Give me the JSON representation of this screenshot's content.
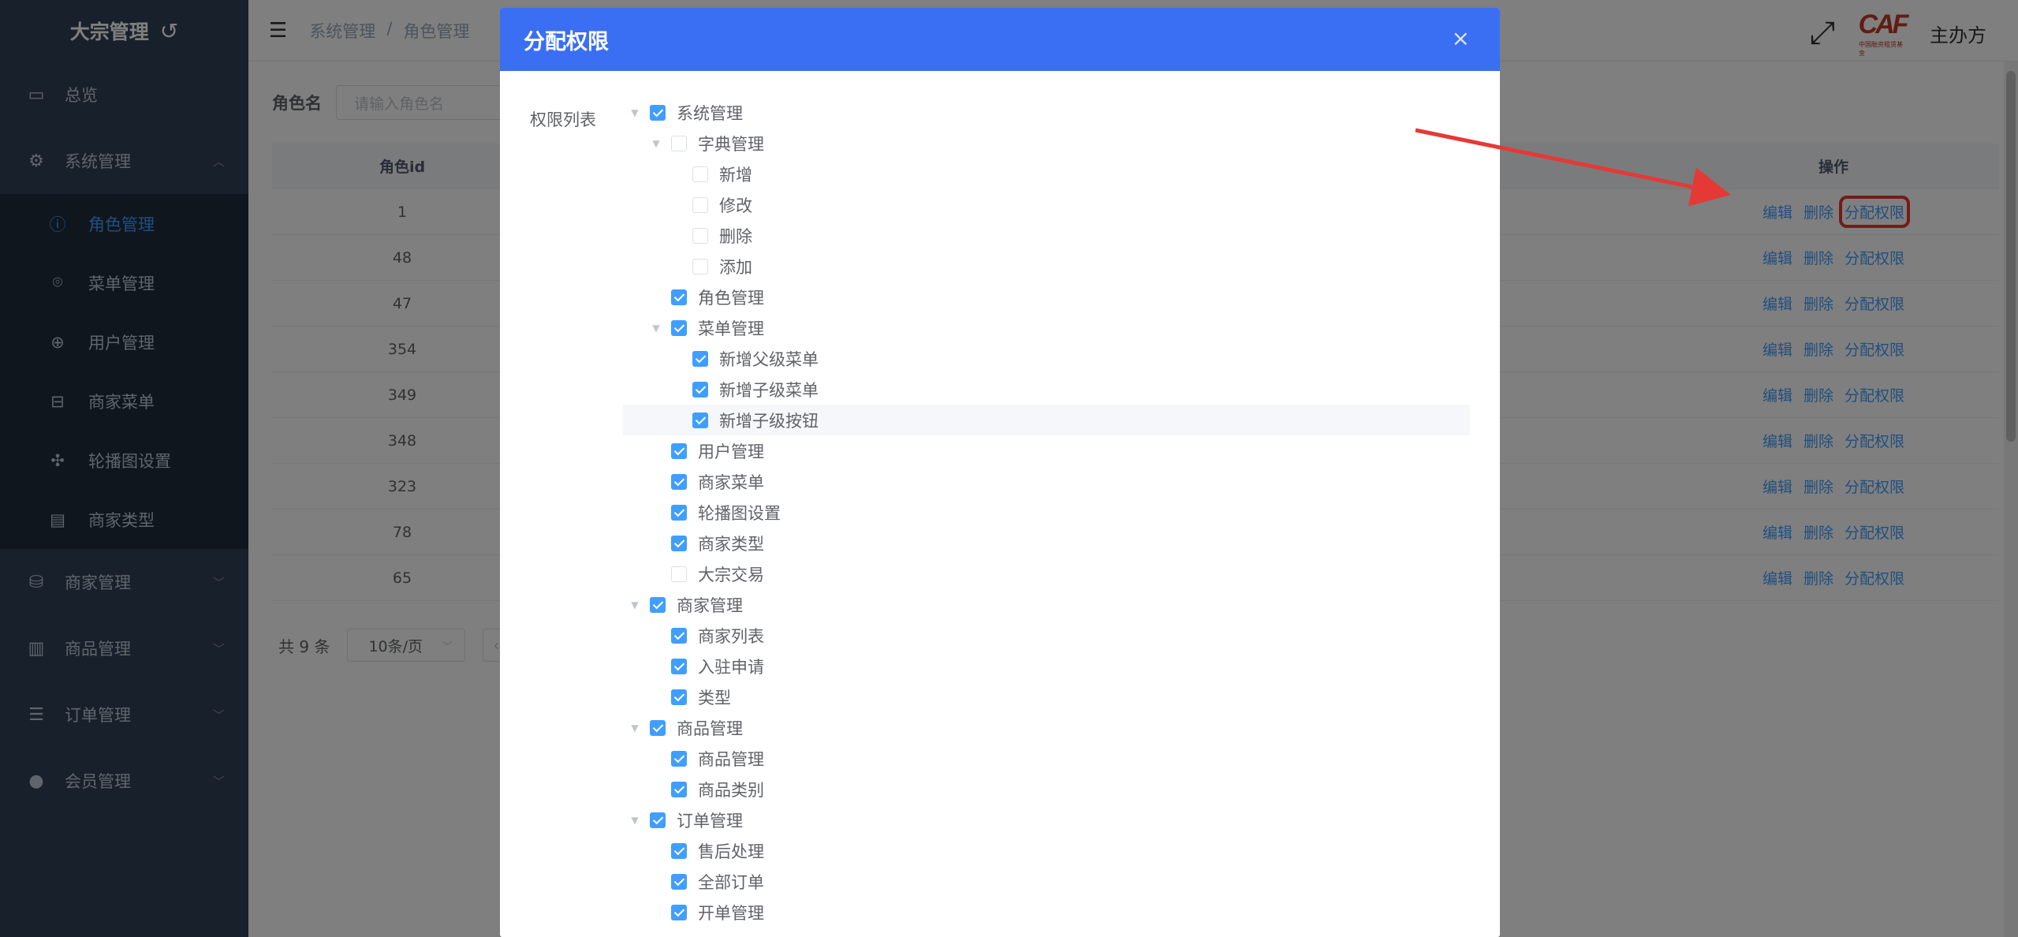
{
  "sidebar": {
    "title": "大宗管理",
    "swap_icon": "↺",
    "items": [
      {
        "label": "总览"
      },
      {
        "label": "系统管理"
      },
      {
        "label": "商家管理"
      },
      {
        "label": "商品管理"
      },
      {
        "label": "订单管理"
      },
      {
        "label": "会员管理"
      }
    ],
    "sub_items": [
      {
        "label": "角色管理"
      },
      {
        "label": "菜单管理"
      },
      {
        "label": "用户管理"
      },
      {
        "label": "商家菜单"
      },
      {
        "label": "轮播图设置"
      },
      {
        "label": "商家类型"
      }
    ]
  },
  "navbar": {
    "breadcrumb": [
      "系统管理",
      "/",
      "角色管理"
    ],
    "username": "主办方",
    "logo_text": "CAF",
    "logo_sub": "中国融资租赁基金"
  },
  "search": {
    "label": "角色名",
    "placeholder": "请输入角色名"
  },
  "table": {
    "headers": {
      "id": "角色id",
      "op": "操作"
    },
    "actions": {
      "edit": "编辑",
      "delete": "删除",
      "assign": "分配权限"
    },
    "rows": [
      {
        "id": "1"
      },
      {
        "id": "48"
      },
      {
        "id": "47"
      },
      {
        "id": "354"
      },
      {
        "id": "349"
      },
      {
        "id": "348"
      },
      {
        "id": "323"
      },
      {
        "id": "78"
      },
      {
        "id": "65"
      }
    ]
  },
  "pager": {
    "total": "共 9 条",
    "page_size": "10条/页"
  },
  "dialog": {
    "title": "分配权限",
    "close": "×",
    "perm_label": "权限列表",
    "tree": [
      {
        "label": "系统管理",
        "level": 0,
        "checked": true,
        "expand": true
      },
      {
        "label": "字典管理",
        "level": 1,
        "checked": false,
        "expand": true
      },
      {
        "label": "新增",
        "level": 2,
        "checked": false,
        "expand": false
      },
      {
        "label": "修改",
        "level": 2,
        "checked": false,
        "expand": false
      },
      {
        "label": "删除",
        "level": 2,
        "checked": false,
        "expand": false
      },
      {
        "label": "添加",
        "level": 2,
        "checked": false,
        "expand": false
      },
      {
        "label": "角色管理",
        "level": 1,
        "checked": true,
        "expand": false
      },
      {
        "label": "菜单管理",
        "level": 1,
        "checked": true,
        "expand": true
      },
      {
        "label": "新增父级菜单",
        "level": 2,
        "checked": true,
        "expand": false
      },
      {
        "label": "新增子级菜单",
        "level": 2,
        "checked": true,
        "expand": false
      },
      {
        "label": "新增子级按钮",
        "level": 2,
        "checked": true,
        "expand": false,
        "hover": true
      },
      {
        "label": "用户管理",
        "level": 1,
        "checked": true,
        "expand": false
      },
      {
        "label": "商家菜单",
        "level": 1,
        "checked": true,
        "expand": false
      },
      {
        "label": "轮播图设置",
        "level": 1,
        "checked": true,
        "expand": false
      },
      {
        "label": "商家类型",
        "level": 1,
        "checked": true,
        "expand": false
      },
      {
        "label": "大宗交易",
        "level": 1,
        "checked": false,
        "expand": false
      },
      {
        "label": "商家管理",
        "level": 0,
        "checked": true,
        "expand": true
      },
      {
        "label": "商家列表",
        "level": 1,
        "checked": true,
        "expand": false
      },
      {
        "label": "入驻申请",
        "level": 1,
        "checked": true,
        "expand": false
      },
      {
        "label": "类型",
        "level": 1,
        "checked": true,
        "expand": false
      },
      {
        "label": "商品管理",
        "level": 0,
        "checked": true,
        "expand": true
      },
      {
        "label": "商品管理",
        "level": 1,
        "checked": true,
        "expand": false
      },
      {
        "label": "商品类别",
        "level": 1,
        "checked": true,
        "expand": false
      },
      {
        "label": "订单管理",
        "level": 0,
        "checked": true,
        "expand": true
      },
      {
        "label": "售后处理",
        "level": 1,
        "checked": true,
        "expand": false
      },
      {
        "label": "全部订单",
        "level": 1,
        "checked": true,
        "expand": false
      },
      {
        "label": "开单管理",
        "level": 1,
        "checked": true,
        "expand": false
      }
    ]
  },
  "colors": {
    "accent": "#409eff",
    "dialog_header": "#3a6ff3",
    "highlight": "#e53935",
    "sidebar": "#304156"
  }
}
